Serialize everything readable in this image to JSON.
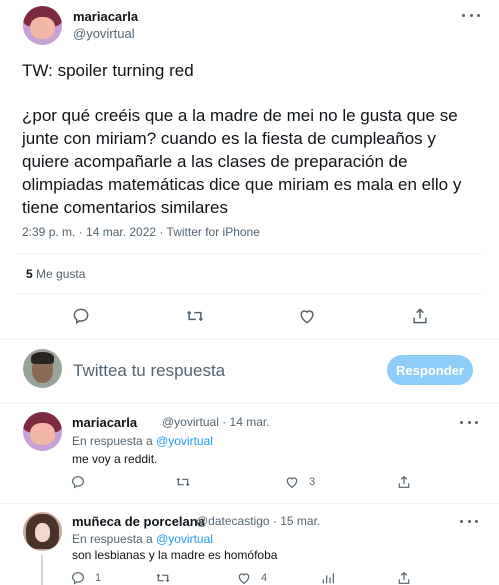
{
  "main_tweet": {
    "author_name": "mariacarla",
    "author_handle": "@yovirtual",
    "text_line_1": "TW: spoiler turning red",
    "text_body": "¿por qué creéis que a la madre de mei no le gusta que se junte con miriam? cuando es la fiesta de cumpleaños y quiere acompañarle a las clases de preparación de olimpiadas matemáticas dice que miriam es mala en ello y tiene comentarios similares",
    "timestamp": "2:39 p. m. · 14 mar. 2022 · Twitter for iPhone",
    "likes_count": "5",
    "likes_label": "Me gusta"
  },
  "composer": {
    "placeholder": "Twittea tu respuesta",
    "reply_button": "Responder"
  },
  "replies": [
    {
      "author_name": "mariacarla",
      "author_handle": "@yovirtual",
      "date": "· 14 mar.",
      "in_reply_prefix": "En respuesta a",
      "in_reply_handle": "@yovirtual",
      "text": "me voy a reddit.",
      "like_count": "3"
    },
    {
      "author_name": "muñeca de porcelana",
      "author_handle": "@datecastigo",
      "date": "· 15 mar.",
      "in_reply_prefix": "En respuesta a",
      "in_reply_handle": "@yovirtual",
      "text": "son lesbianas y la madre es homófoba",
      "reply_count": "1",
      "like_count": "4"
    }
  ],
  "icons": {
    "reply": "reply-icon",
    "retweet": "retweet-icon",
    "like": "heart-icon",
    "share": "share-icon",
    "more": "more-icon"
  },
  "colors": {
    "accent": "#1d9bf0",
    "button_disabled": "#8ecdf7",
    "secondary_text": "#536471",
    "divider": "#eff3f4"
  }
}
